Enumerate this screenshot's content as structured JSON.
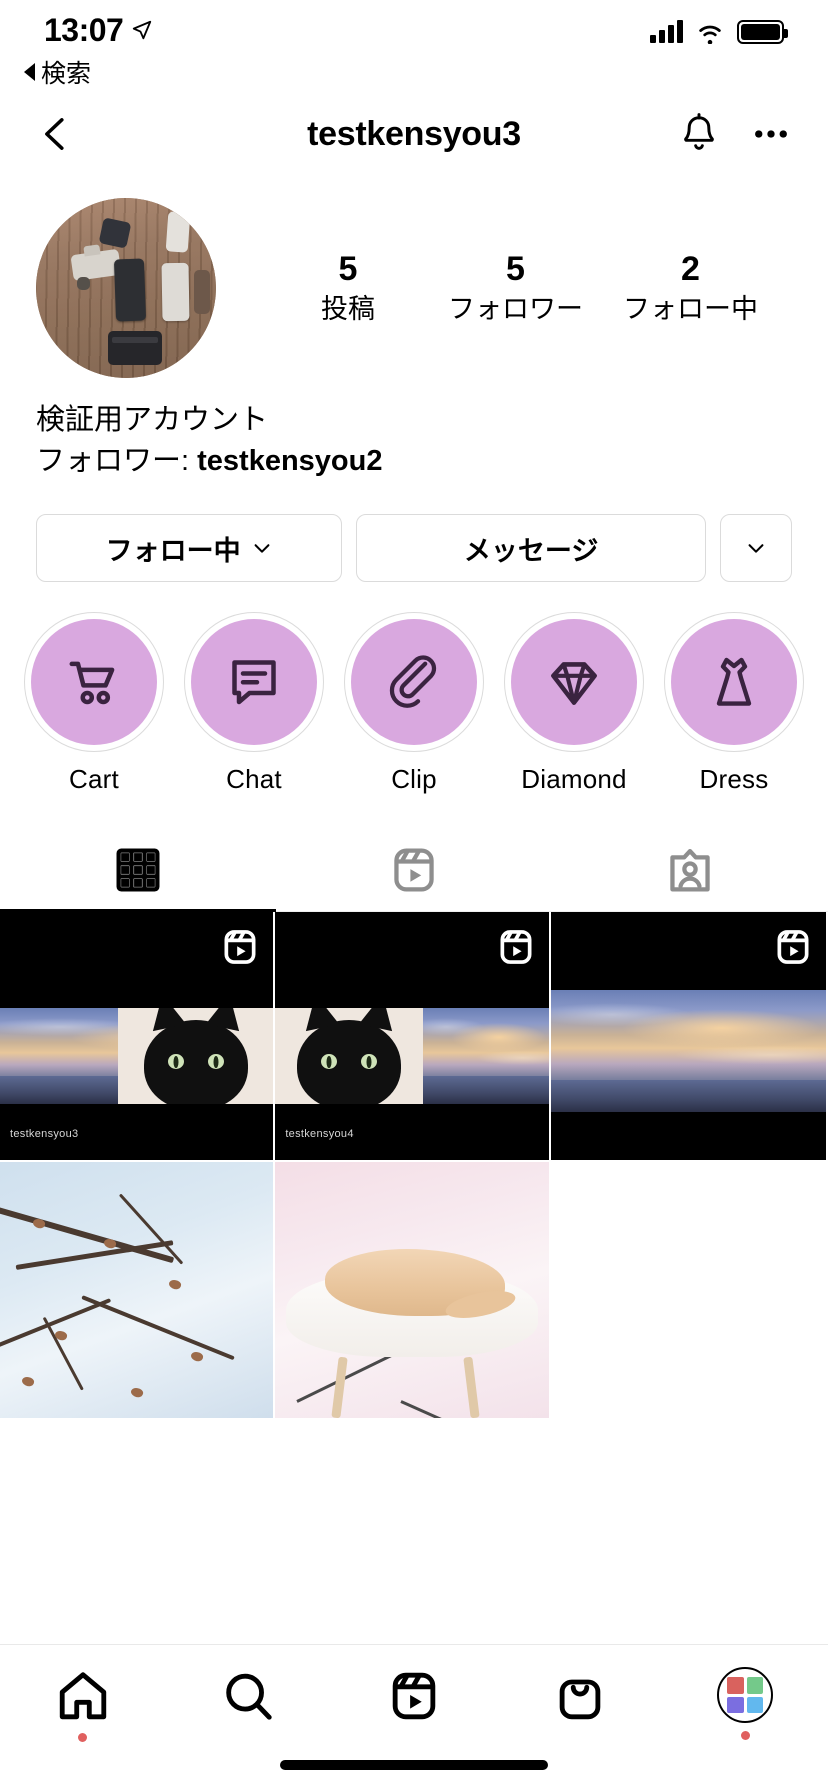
{
  "status_bar": {
    "time": "13:07",
    "back_app_label": "検索",
    "location_icon": "location-arrow-icon",
    "signal_icon": "cellular-signal-icon",
    "wifi_icon": "wifi-icon",
    "battery_icon": "battery-full-icon"
  },
  "nav_header": {
    "back_icon": "back-chevron-icon",
    "title": "testkensyou3",
    "bell_icon": "notification-bell-icon",
    "more_icon": "more-options-icon"
  },
  "profile": {
    "avatar_alt": "profile-photo-desk-with-phones",
    "stats": [
      {
        "value": "5",
        "label": "投稿"
      },
      {
        "value": "5",
        "label": "フォロワー"
      },
      {
        "value": "2",
        "label": "フォロー中"
      }
    ],
    "bio_name": "検証用アカウント",
    "bio_follower_prefix": "フォロワー: ",
    "bio_follower_user": "testkensyou2"
  },
  "actions": {
    "following_label": "フォロー中",
    "message_label": "メッセージ",
    "more_icon": "chevron-down-icon"
  },
  "highlights": [
    {
      "label": "Cart",
      "icon": "shopping-cart-icon",
      "color": "#d9a8df"
    },
    {
      "label": "Chat",
      "icon": "chat-bubble-icon",
      "color": "#d9a8df"
    },
    {
      "label": "Clip",
      "icon": "paperclip-icon",
      "color": "#d9a8df"
    },
    {
      "label": "Diamond",
      "icon": "diamond-icon",
      "color": "#d9a8df"
    },
    {
      "label": "Dress",
      "icon": "dress-icon",
      "color": "#d9a8df"
    }
  ],
  "tabs": [
    {
      "name": "grid",
      "icon": "grid-icon",
      "active": true
    },
    {
      "name": "reels",
      "icon": "reels-icon",
      "active": false
    },
    {
      "name": "tagged",
      "icon": "tagged-person-icon",
      "active": false
    }
  ],
  "grid_posts": [
    {
      "type": "reel",
      "badge": "reel-icon",
      "watermark": "testkensyou3"
    },
    {
      "type": "reel",
      "badge": "reel-icon",
      "watermark": "testkensyou4"
    },
    {
      "type": "reel",
      "badge": "reel-icon",
      "watermark": ""
    },
    {
      "type": "photo",
      "badge": "",
      "watermark": ""
    },
    {
      "type": "photo",
      "badge": "",
      "watermark": ""
    }
  ],
  "bottom_nav": [
    {
      "name": "home",
      "icon": "home-icon",
      "dot": true
    },
    {
      "name": "search",
      "icon": "search-icon",
      "dot": false
    },
    {
      "name": "reels",
      "icon": "reels-icon",
      "dot": false
    },
    {
      "name": "shop",
      "icon": "shopping-bag-icon",
      "dot": false
    },
    {
      "name": "profile",
      "icon": "profile-avatar-icon",
      "dot": true
    }
  ],
  "colors": {
    "highlight_fill": "#d9a8df",
    "notification_dot": "#e0605f",
    "accent_text": "#000000"
  }
}
